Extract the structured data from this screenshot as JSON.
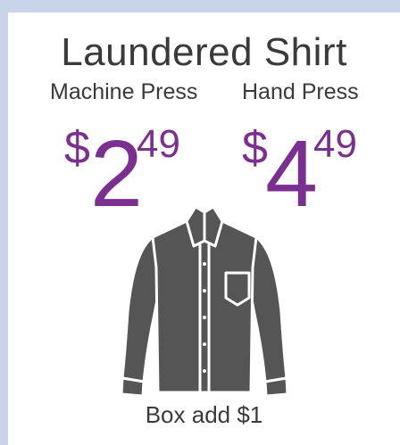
{
  "title": "Laundered Shirt",
  "options": [
    {
      "label": "Machine Press",
      "currency": "$",
      "whole": "2",
      "cents": "49"
    },
    {
      "label": "Hand Press",
      "currency": "$",
      "whole": "4",
      "cents": "49"
    }
  ],
  "footer": "Box add $1",
  "colors": {
    "price": "#7b2f91",
    "text": "#3a3a3a",
    "shirt": "#555555",
    "background": "#c9d3ea"
  },
  "icon": "shirt-icon"
}
